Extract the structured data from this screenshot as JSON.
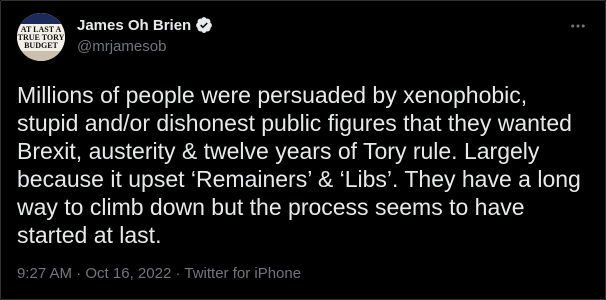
{
  "author": {
    "display_name": "James Oh Brien",
    "handle": "@mrjamesob",
    "avatar_text": [
      "AT LAST A",
      "TRUE TORY",
      "BUDGET"
    ]
  },
  "tweet": {
    "lines": [
      "Millions of people were persuaded by xenophobic,",
      "stupid and/or dishonest public figures that they wanted",
      "Brexit, austerity & twelve years of Tory rule. Largely",
      "because it upset ‘Remainers’ & ‘Libs’. They have a long",
      "way to climb down but the process seems to have",
      "started at last."
    ]
  },
  "meta": {
    "time": "9:27 AM",
    "separator": " · ",
    "date": "Oct 16, 2022",
    "source": "Twitter for iPhone"
  },
  "icons": {
    "verified": "verified-badge-icon",
    "more": "more-options-icon"
  },
  "colors": {
    "background": "#000000",
    "text_primary": "#e7e9ea",
    "text_secondary": "#71767b",
    "border": "#2f3336"
  }
}
